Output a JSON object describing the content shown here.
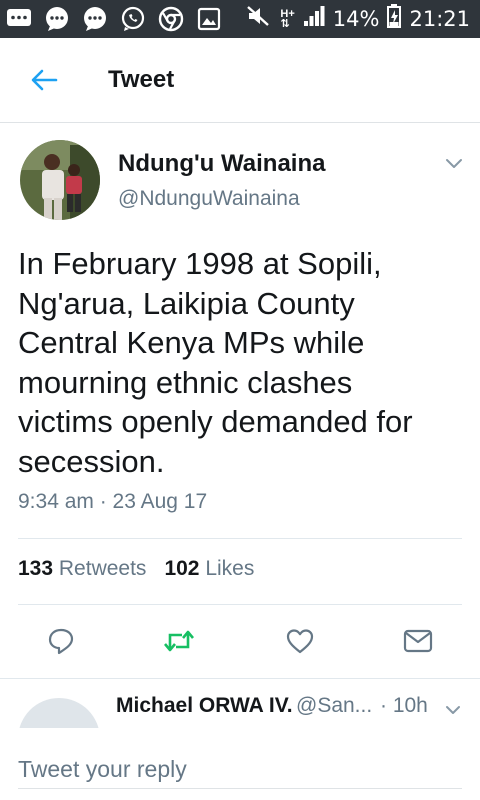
{
  "status_bar": {
    "battery": "14%",
    "time": "21:21",
    "network": "H+"
  },
  "header": {
    "title": "Tweet"
  },
  "tweet": {
    "author_name": "Ndung'u Wainaina",
    "author_handle": "@NdunguWainaina",
    "text": "In February 1998 at Sopili,\nNg'arua, Laikipia County\nCentral Kenya MPs while\nmourning ethnic clashes\nvictims openly demanded for\nsecession.",
    "timestamp": "9:34 am · 23 Aug 17",
    "retweets_count": "133",
    "retweets_label": "Retweets",
    "likes_count": "102",
    "likes_label": "Likes"
  },
  "reply_preview": {
    "name": "Michael ORWA IV.",
    "handle": "@San...",
    "time": "· 10h"
  },
  "composer": {
    "placeholder": "Tweet your reply"
  },
  "colors": {
    "accent": "#1da1f2",
    "retweet_green": "#17bf63",
    "secondary_text": "#657786",
    "status_bar_bg": "#2f353b"
  }
}
